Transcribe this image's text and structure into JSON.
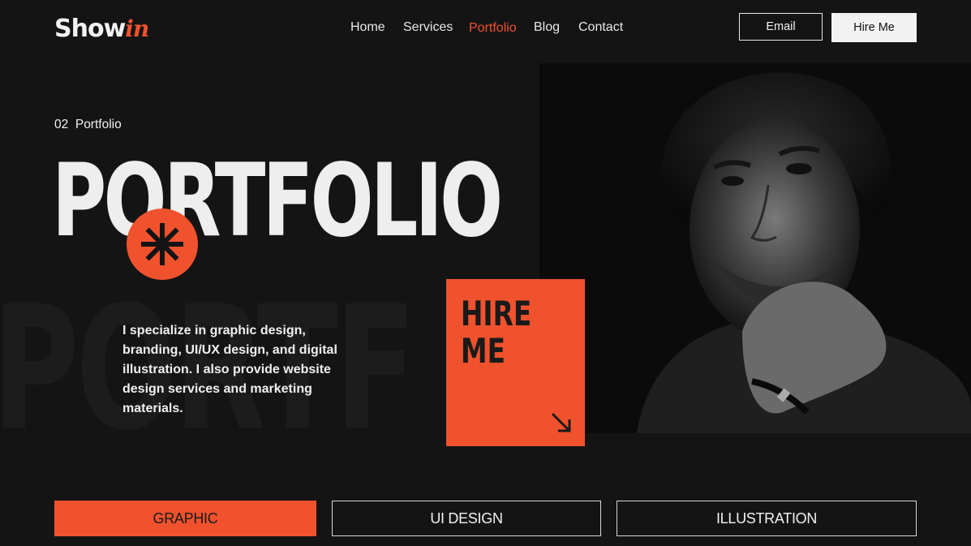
{
  "brand": {
    "name_main": "Show",
    "name_accent": "in",
    "accent_color": "#f0522e"
  },
  "nav": {
    "items": [
      {
        "label": "Home",
        "active": false
      },
      {
        "label": "Services",
        "active": false
      },
      {
        "label": "Portfolio",
        "active": true
      },
      {
        "label": "Blog",
        "active": false
      },
      {
        "label": "Contact",
        "active": false
      }
    ],
    "email_label": "Email",
    "hire_label": "Hire Me"
  },
  "hero": {
    "eyebrow": "02  Portfolio",
    "title": "PORTFOLIO",
    "background_word": "PORTF",
    "badge_icon": "asterisk-icon",
    "description": "I specialize in graphic design, branding, UI/UX design, and digital illustration. I also provide website design services and marketing materials."
  },
  "hire_card": {
    "label": "HIRE\nME",
    "icon": "arrow-down-right-icon"
  },
  "photo": {
    "subject": "portrait-photo"
  },
  "tabs": [
    {
      "label": "GRAPHIC",
      "active": true
    },
    {
      "label": "UI DESIGN",
      "active": false
    },
    {
      "label": "ILLUSTRATION",
      "active": false
    }
  ]
}
